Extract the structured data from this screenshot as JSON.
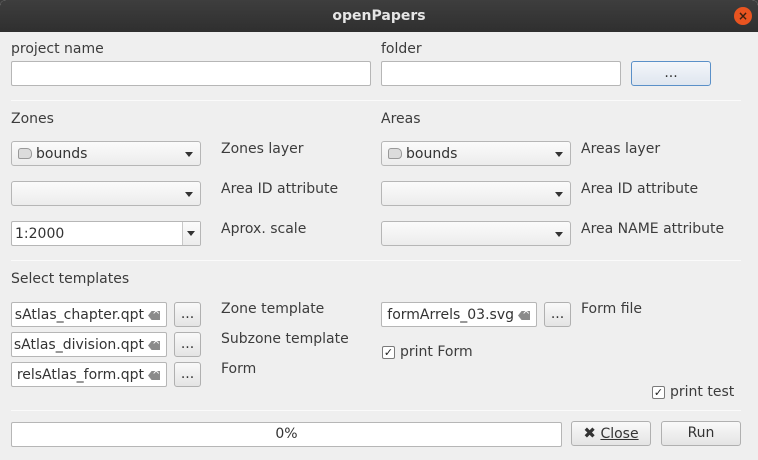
{
  "window": {
    "title": "openPapers"
  },
  "project": {
    "name_label": "project name",
    "name_value": "",
    "folder_label": "folder",
    "folder_value": "",
    "browse_label": "..."
  },
  "zones": {
    "heading": "Zones",
    "layer_value": "bounds",
    "layer_label": "Zones layer",
    "id_value": "",
    "id_label": "Area ID attribute",
    "scale_value": "1:2000",
    "scale_label": "Aprox. scale"
  },
  "areas": {
    "heading": "Areas",
    "layer_value": "bounds",
    "layer_label": "Areas layer",
    "id_value": "",
    "id_label": "Area ID attribute",
    "name_value": "",
    "name_label": "Area NAME attribute"
  },
  "templates": {
    "heading": "Select templates",
    "zone_value": "sAtlas_chapter.qpt",
    "zone_label": "Zone template",
    "subzone_value": "sAtlas_division.qpt",
    "subzone_label": "Subzone template",
    "form_value": "relsAtlas_form.qpt",
    "form_label": "Form",
    "form_file_value": "formArrels_03.svg",
    "form_file_label": "Form file",
    "browse_label": "...",
    "print_form_label": "print Form",
    "print_form_checked": "✓",
    "print_test_label": "print test",
    "print_test_checked": "✓"
  },
  "footer": {
    "progress_text": "0%",
    "progress_value": 0,
    "close_label": "Close",
    "run_label": "Run"
  }
}
